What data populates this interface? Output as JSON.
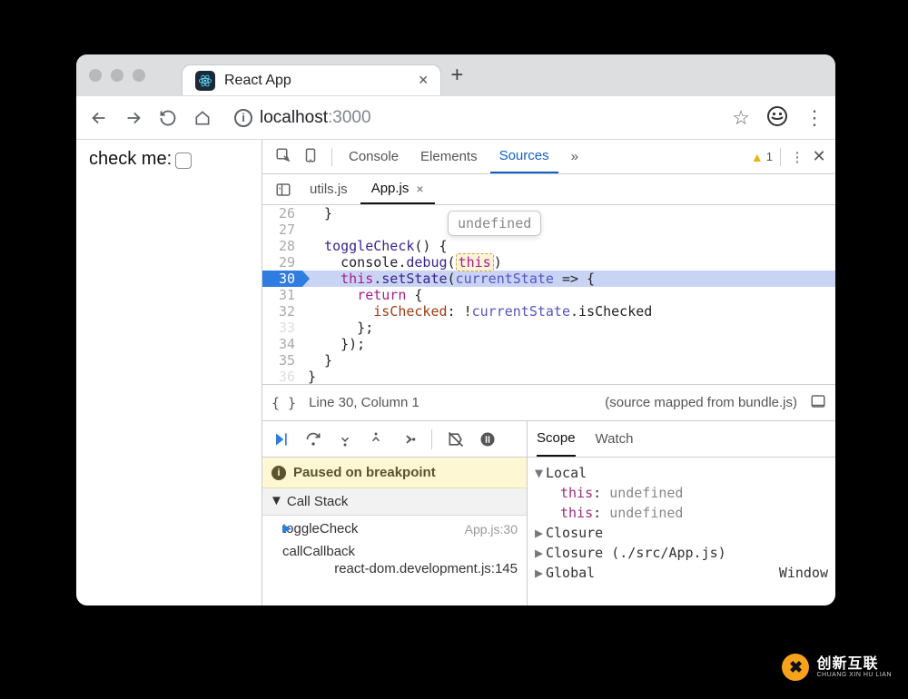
{
  "browser": {
    "tab_title": "React App",
    "url_host": "localhost",
    "url_port": ":3000"
  },
  "page": {
    "label": "check me:"
  },
  "devtools": {
    "tabs": {
      "console": "Console",
      "elements": "Elements",
      "sources": "Sources",
      "more": "»"
    },
    "warnings": "1",
    "file_tabs": {
      "utils": "utils.js",
      "app": "App.js"
    },
    "tooltip": "undefined",
    "code": {
      "l26": {
        "n": "26",
        "t": "  }"
      },
      "l27": {
        "n": "27",
        "t": ""
      },
      "l28": {
        "n": "28",
        "fn": "toggleCheck",
        "rest": "() {"
      },
      "l29": {
        "n": "29",
        "pre": "    console.",
        "fn": "debug",
        "open": "(",
        "this": "this",
        "close": ")"
      },
      "l30": {
        "n": "30",
        "pre": "    ",
        "this": "this",
        "mid": ".",
        "fn": "setState",
        "open": "(",
        "arg": "currentState",
        "arrow": " => {"
      },
      "l31": {
        "n": "31",
        "kw": "return",
        "rest": " {"
      },
      "l32": {
        "n": "32",
        "key": "isChecked",
        "sep": ": !",
        "obj": "currentState",
        "prop": ".isChecked"
      },
      "l33": {
        "n": "33",
        "t": "      };"
      },
      "l34": {
        "n": "34",
        "t": "    });"
      },
      "l35": {
        "n": "35",
        "t": "  }"
      },
      "l36": {
        "n": "36",
        "t": "}"
      }
    },
    "status": {
      "cursor": "Line 30, Column 1",
      "mapped": "(source mapped from bundle.js)"
    },
    "paused": "Paused on breakpoint",
    "callstack_title": "Call Stack",
    "frames": {
      "f0": {
        "name": "toggleCheck",
        "loc": "App.js:30"
      },
      "f1": {
        "name": "callCallback",
        "loc": "react-dom.development.js:145"
      }
    },
    "scope_tabs": {
      "scope": "Scope",
      "watch": "Watch"
    },
    "scope": {
      "local": "Local",
      "this1_key": "this",
      "this1_val": "undefined",
      "this2_key": "this",
      "this2_val": "undefined",
      "closure1": "Closure",
      "closure2": "Closure (./src/App.js)",
      "global": "Global",
      "global_val": "Window"
    }
  },
  "logo": {
    "cn": "创新互联",
    "en": "CHUANG XIN HU LIAN"
  }
}
